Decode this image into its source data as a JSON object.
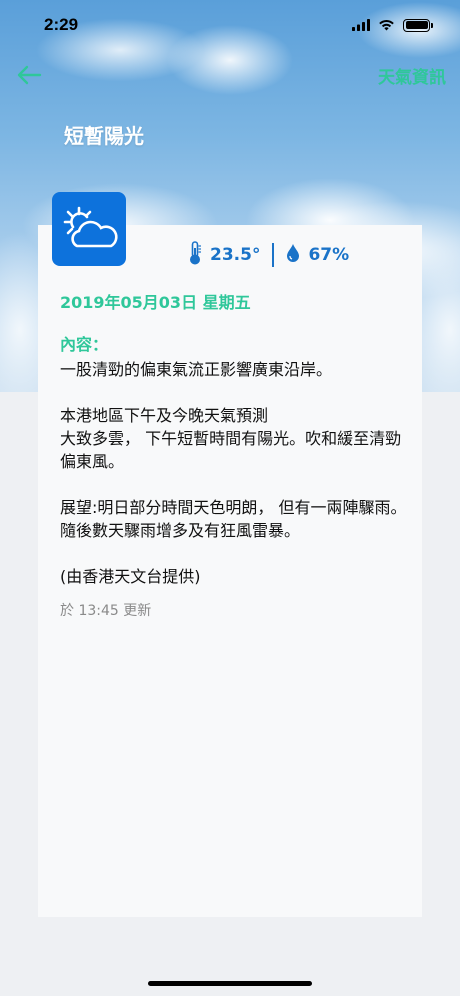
{
  "status": {
    "time": "2:29"
  },
  "nav": {
    "back_icon": "arrow-left",
    "title": "天氣資訊",
    "accent_color": "#2fc79a"
  },
  "condition": {
    "title": "短暫陽光",
    "icon": "partly-sunny-icon",
    "icon_bg_color": "#0d72dc"
  },
  "stats": {
    "temperature": "23.5°",
    "humidity": "67%",
    "color": "#1a73c8"
  },
  "date": "2019年05月03日 星期五",
  "content": {
    "label": "內容：",
    "paragraphs": [
      [
        "一股清勁的偏東氣流正影響廣東沿岸。"
      ],
      [
        "本港地區下午及今晚天氣預測",
        "大致多雲， 下午短暫時間有陽光。吹和緩至清勁偏東風。"
      ],
      [
        "展望:明日部分時間天色明朗， 但有一兩陣驟雨。隨後數天驟雨增多及有狂風雷暴。"
      ],
      [
        "(由香港天文台提供)"
      ]
    ]
  },
  "updated": "於 13:45 更新"
}
